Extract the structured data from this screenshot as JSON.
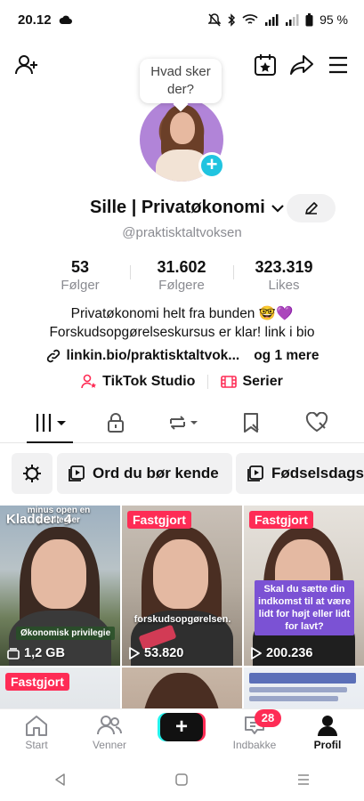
{
  "status_bar": {
    "time": "20.12",
    "battery": "95 %"
  },
  "bubble": {
    "line1": "Hvad sker",
    "line2": "der?"
  },
  "profile": {
    "name": "Sille | Privatøkonomi",
    "handle": "@praktisktaltvoksen",
    "stats": [
      {
        "value": "53",
        "label": "Følger"
      },
      {
        "value": "31.602",
        "label": "Følgere"
      },
      {
        "value": "323.319",
        "label": "Likes"
      }
    ],
    "bio_line1": "Privatøkonomi helt fra bunden 🤓💜",
    "bio_line2": "Forskudsopgørelseskursus er klar! link i bio",
    "link": "linkin.bio/praktisktaltvok...",
    "link_more": "og 1 mere",
    "studio": "TikTok Studio",
    "series": "Serier"
  },
  "chips": [
    {
      "label": "Ord du bør kende"
    },
    {
      "label": "Fødselsdags"
    }
  ],
  "videos": [
    {
      "overlay": "Kladder: 4",
      "meta": "1,2 GB",
      "caption": "Økonomisk privilegie",
      "top_caption": "minus open en privilegier"
    },
    {
      "overlay": "Fastgjort",
      "meta": "53.820",
      "caption": "forskudsopgørelsen."
    },
    {
      "overlay": "Fastgjort",
      "meta": "200.236",
      "caption": "Skal du sætte din indkomst til at være lidt for højt eller lidt for lavt?"
    },
    {
      "overlay": "Fastgjort"
    }
  ],
  "bottom_nav": {
    "home": "Start",
    "friends": "Venner",
    "inbox": "Indbakke",
    "inbox_badge": "28",
    "profile": "Profil"
  },
  "colors": {
    "accent": "#fe2c55",
    "cyan": "#25f4ee",
    "badge_blue": "#20c4e0"
  }
}
